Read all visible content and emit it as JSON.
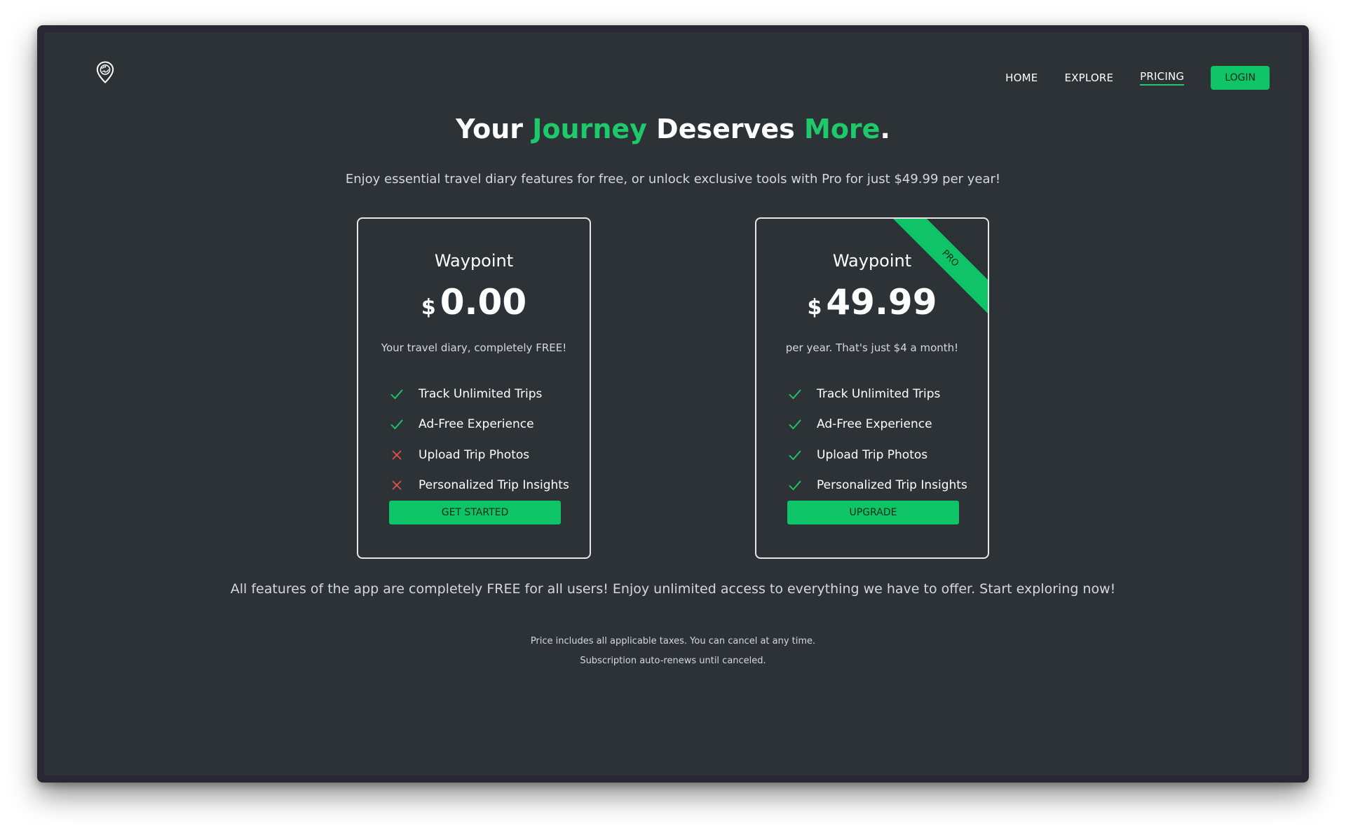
{
  "nav": {
    "home": "HOME",
    "explore": "EXPLORE",
    "pricing": "PRICING",
    "login": "LOGIN"
  },
  "hero": {
    "part1": "Your ",
    "accent1": "Journey",
    "part2": " Deserves ",
    "accent2": "More",
    "part3": ".",
    "subtitle": "Enjoy essential travel diary features for free, or unlock exclusive tools with Pro for just $49.99 per year!"
  },
  "plans": [
    {
      "name": "Waypoint",
      "currency": "$",
      "price": "0.00",
      "description": "Your travel diary, completely FREE!",
      "features": [
        {
          "label": "Track Unlimited Trips",
          "included": true
        },
        {
          "label": "Ad-Free Experience",
          "included": true
        },
        {
          "label": "Upload Trip Photos",
          "included": false
        },
        {
          "label": "Personalized Trip Insights",
          "included": false
        }
      ],
      "cta": "GET STARTED"
    },
    {
      "name": "Waypoint",
      "ribbon": "PRO",
      "currency": "$",
      "price": "49.99",
      "description": "per year. That's just $4 a month!",
      "features": [
        {
          "label": "Track Unlimited Trips",
          "included": true
        },
        {
          "label": "Ad-Free Experience",
          "included": true
        },
        {
          "label": "Upload Trip Photos",
          "included": true
        },
        {
          "label": "Personalized Trip Insights",
          "included": true
        }
      ],
      "cta": "UPGRADE"
    }
  ],
  "footer": {
    "note": "All features of the app are completely FREE for all users! Enjoy unlimited access to everything we have to offer. Start exploring now!",
    "fine1": "Price includes all applicable taxes. You can cancel at any time.",
    "fine2": "Subscription auto-renews until canceled."
  },
  "colors": {
    "accent": "#1ec96b",
    "background": "#2d3236",
    "included": "#1ec96b",
    "excluded": "#e0514c"
  },
  "icons": {
    "logo": "map-pin-globe-icon",
    "included": "check-icon",
    "excluded": "x-icon"
  }
}
